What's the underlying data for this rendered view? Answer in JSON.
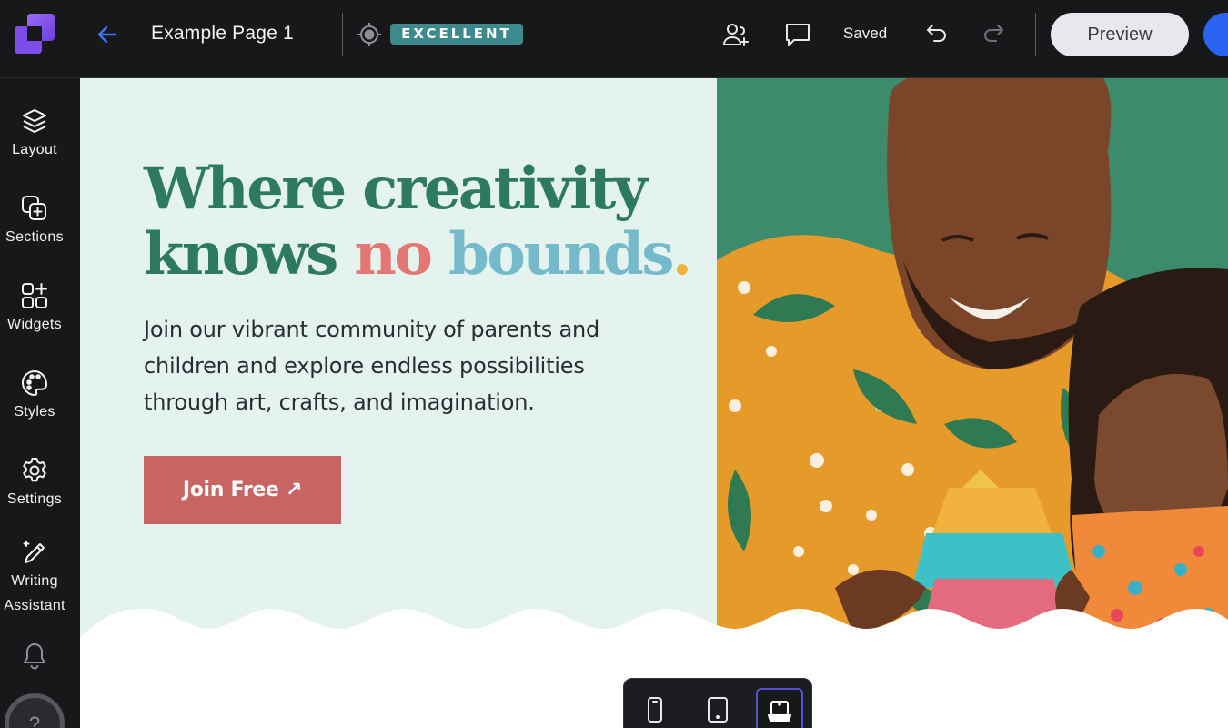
{
  "header": {
    "page_title": "Example Page 1",
    "seo_score_label": "EXCELLENT",
    "save_status": "Saved",
    "preview_label": "Preview",
    "icons": [
      "app-logo",
      "back-arrow-icon",
      "target-icon",
      "add-user-icon",
      "comment-icon",
      "undo-icon",
      "redo-icon"
    ]
  },
  "sidebar": {
    "items": [
      {
        "label": "Layout",
        "icon": "layers-icon"
      },
      {
        "label": "Sections",
        "icon": "add-section-icon"
      },
      {
        "label": "Widgets",
        "icon": "widgets-icon"
      },
      {
        "label": "Styles",
        "icon": "palette-icon"
      },
      {
        "label": "Settings",
        "icon": "gear-icon"
      },
      {
        "label": "Writing Assistant",
        "icon": "magic-pen-icon"
      }
    ],
    "notifications_icon": "bell-icon",
    "help_label": "?"
  },
  "hero": {
    "headline_part1": "Where creativity knows ",
    "headline_no": "no",
    "headline_bounds": " bounds",
    "headline_dot": ".",
    "body": "Join our vibrant community of parents and children and explore endless possibilities through art, crafts, and imagination.",
    "cta_label": "Join Free ↗",
    "image_alt": "Father and daughter building a colorful paper craft tower"
  },
  "device_switcher": {
    "options": [
      "mobile",
      "tablet",
      "desktop"
    ],
    "selected": "desktop"
  },
  "colors": {
    "topbar_bg": "#17181a",
    "hero_bg": "#e5f3ef",
    "headline_green": "#2e7a5e",
    "headline_coral": "#e27774",
    "headline_blue": "#74bacb",
    "headline_yellow": "#f0b43c",
    "cta_bg": "#c86461",
    "badge_bg": "#3d8a8e",
    "preview_bg": "#e7e8ec",
    "publish_blue": "#2b63f5"
  }
}
